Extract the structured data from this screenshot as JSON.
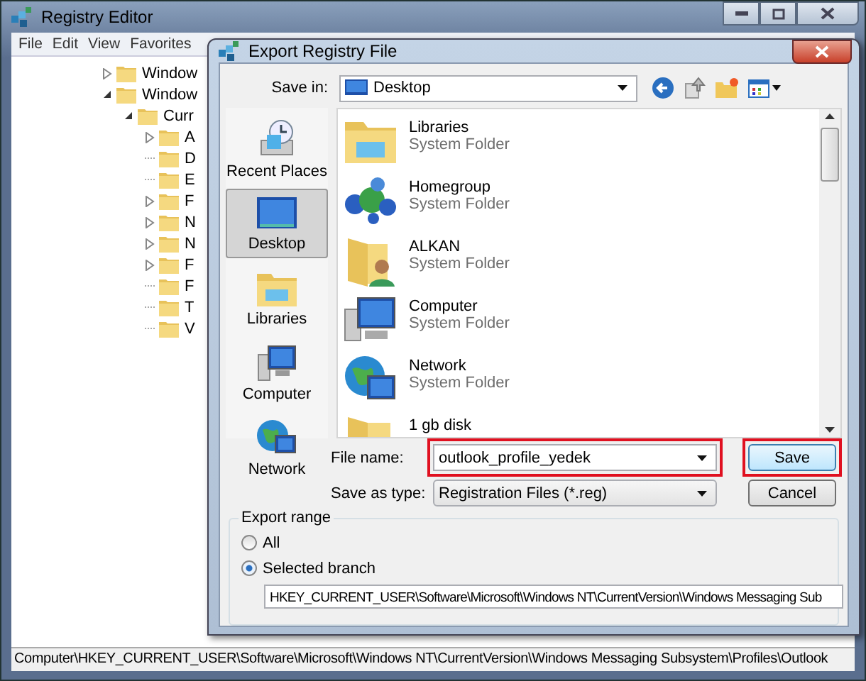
{
  "registry_window": {
    "title": "Registry Editor",
    "menu": [
      "File",
      "Edit",
      "View",
      "Favorites"
    ],
    "tree": [
      {
        "label": "Window",
        "expanded": false
      },
      {
        "label": "Window",
        "expanded": true,
        "children": [
          {
            "label": "Curr",
            "expanded": true,
            "children": [
              {
                "label": "A",
                "expanded": false
              },
              {
                "label": "D"
              },
              {
                "label": "E"
              },
              {
                "label": "F",
                "expanded": false
              },
              {
                "label": "N",
                "expanded": false
              },
              {
                "label": "N",
                "expanded": false
              },
              {
                "label": "F",
                "expanded": false
              },
              {
                "label": "F"
              },
              {
                "label": "T"
              },
              {
                "label": "V"
              }
            ]
          }
        ]
      }
    ],
    "status_bar": "Computer\\HKEY_CURRENT_USER\\Software\\Microsoft\\Windows NT\\CurrentVersion\\Windows Messaging Subsystem\\Profiles\\Outlook"
  },
  "dialog": {
    "title": "Export Registry File",
    "save_in": {
      "label": "Save in:",
      "value": "Desktop"
    },
    "places": [
      {
        "label": "Recent Places",
        "kind": "recent",
        "selected": false
      },
      {
        "label": "Desktop",
        "kind": "desktop",
        "selected": true
      },
      {
        "label": "Libraries",
        "kind": "library",
        "selected": false
      },
      {
        "label": "Computer",
        "kind": "computer",
        "selected": false
      },
      {
        "label": "Network",
        "kind": "network",
        "selected": false
      }
    ],
    "files": [
      {
        "name": "Libraries",
        "type": "System Folder",
        "kind": "library"
      },
      {
        "name": "Homegroup",
        "type": "System Folder",
        "kind": "homegroup"
      },
      {
        "name": "ALKAN",
        "type": "System Folder",
        "kind": "user"
      },
      {
        "name": "Computer",
        "type": "System Folder",
        "kind": "computer"
      },
      {
        "name": "Network",
        "type": "System Folder",
        "kind": "network"
      },
      {
        "name": "1 gb disk",
        "kind": "folder"
      }
    ],
    "file_name": {
      "label": "File name:",
      "value": "outlook_profile_yedek",
      "highlighted": true
    },
    "save_as_type": {
      "label": "Save as type:",
      "value": "Registration Files (*.reg)"
    },
    "buttons": [
      {
        "label": "Save",
        "highlighted": true,
        "default": true
      },
      {
        "label": "Cancel",
        "default": false
      }
    ],
    "export_range": {
      "title": "Export range",
      "options": [
        {
          "label": "All",
          "selected": false
        },
        {
          "label": "Selected branch",
          "selected": true
        }
      ],
      "branch": "HKEY_CURRENT_USER\\Software\\Microsoft\\Windows NT\\CurrentVersion\\Windows Messaging Sub"
    }
  }
}
